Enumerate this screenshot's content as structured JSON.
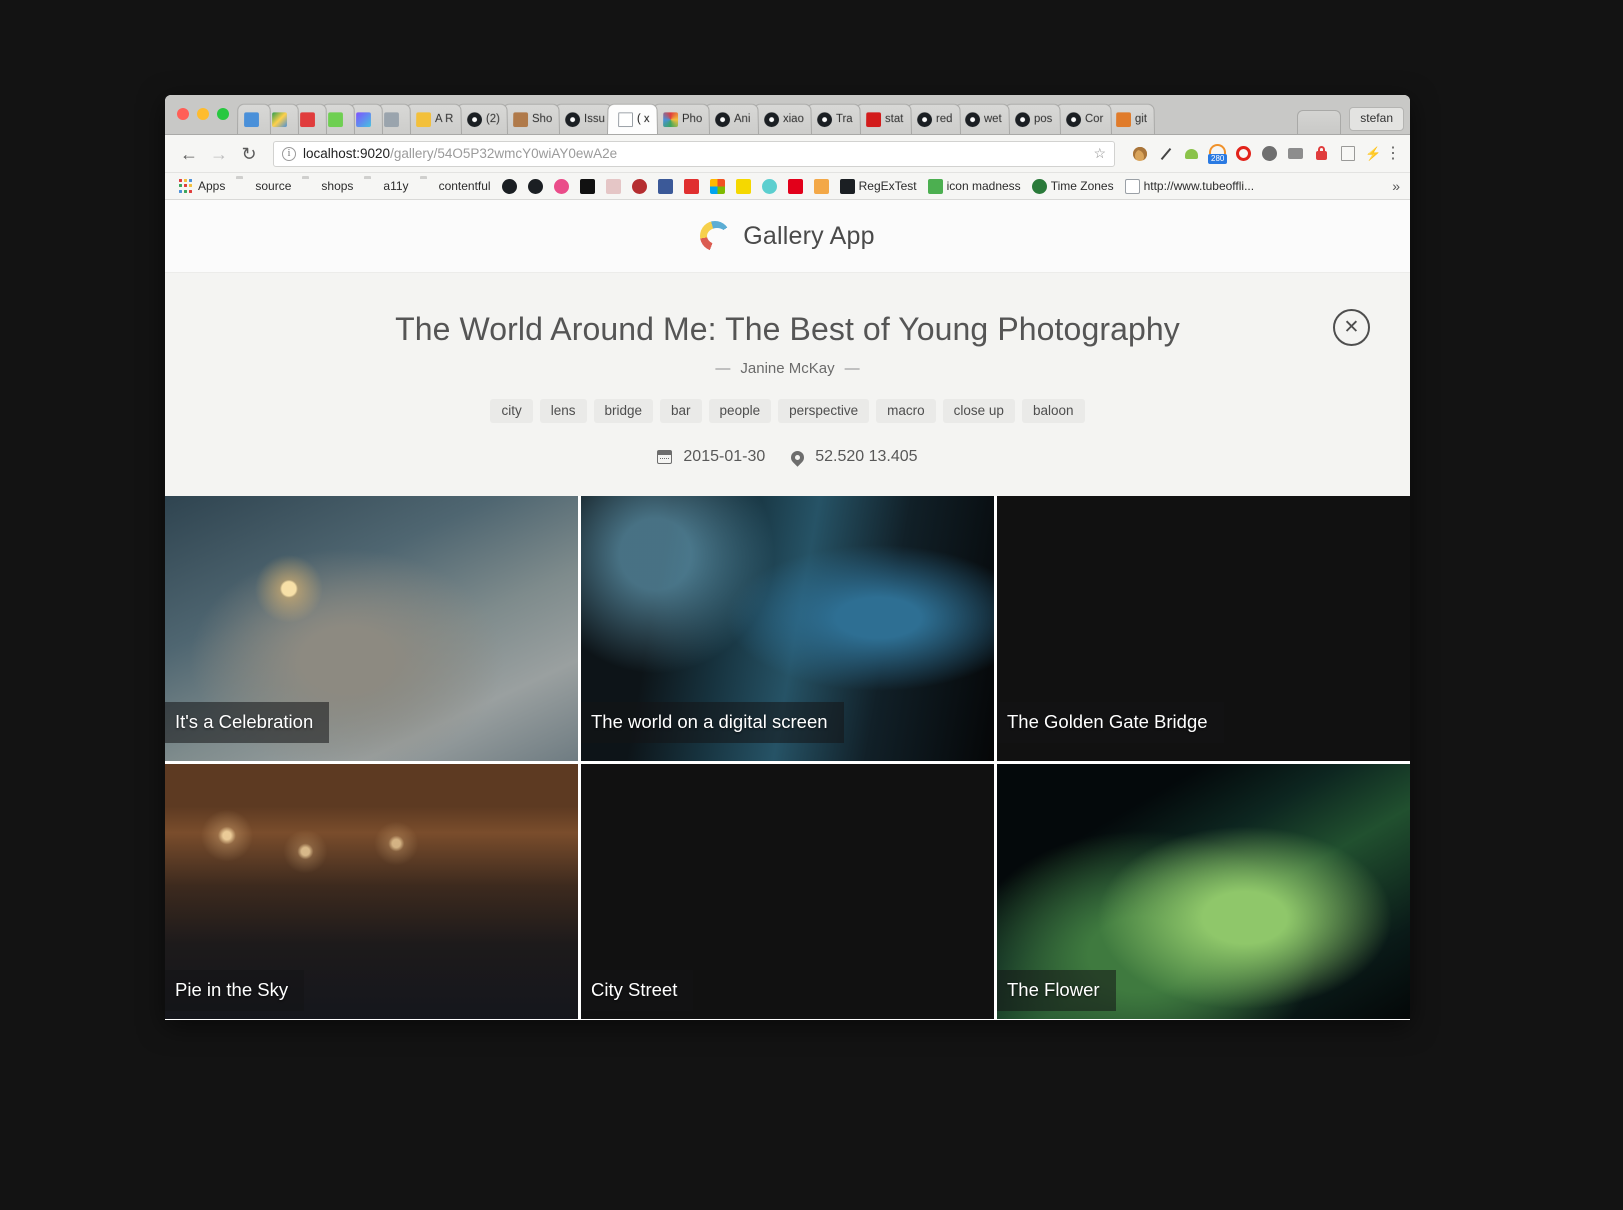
{
  "browser": {
    "tabs": [
      {
        "label": "",
        "favicon_name": "gerrit-icon",
        "color": "#e8e8e6",
        "active": false,
        "narrow": true
      },
      {
        "label": "",
        "favicon_name": "google-drive-icon",
        "color": "#e8e8e6",
        "active": false,
        "narrow": true
      },
      {
        "label": "",
        "favicon_name": "red-app-icon",
        "color": "#e8e8e6",
        "active": false,
        "narrow": true
      },
      {
        "label": "",
        "favicon_name": "green-circle-icon",
        "color": "#e8e8e6",
        "active": false,
        "narrow": true
      },
      {
        "label": "",
        "favicon_name": "kotlin-icon",
        "color": "#e8e8e6",
        "active": false,
        "narrow": true
      },
      {
        "label": "",
        "favicon_name": "refresh-icon",
        "color": "#e8e8e6",
        "active": false,
        "narrow": true
      },
      {
        "label": "A R",
        "favicon_name": "hexagon-icon",
        "color": "#e8e8e6",
        "active": false,
        "narrow": false
      },
      {
        "label": "(2)",
        "favicon_name": "github-icon",
        "color": "#e8e8e6",
        "active": false,
        "narrow": false
      },
      {
        "label": "Sho",
        "favicon_name": "avatar-icon",
        "color": "#e8e8e6",
        "active": false,
        "narrow": false
      },
      {
        "label": "Issu",
        "favicon_name": "github-icon",
        "color": "#e8e8e6",
        "active": false,
        "narrow": false
      },
      {
        "label": "( x",
        "favicon_name": "page-icon",
        "color": "#ffffff",
        "active": true,
        "narrow": false
      },
      {
        "label": "Pho",
        "favicon_name": "photos-icon",
        "color": "#e8e8e6",
        "active": false,
        "narrow": false
      },
      {
        "label": "Ani",
        "favicon_name": "github-icon",
        "color": "#e8e8e6",
        "active": false,
        "narrow": false
      },
      {
        "label": "xiao",
        "favicon_name": "github-icon",
        "color": "#e8e8e6",
        "active": false,
        "narrow": false
      },
      {
        "label": "Tra",
        "favicon_name": "github-icon",
        "color": "#e8e8e6",
        "active": false,
        "narrow": false
      },
      {
        "label": "stat",
        "favicon_name": "red-square-icon",
        "color": "#e8e8e6",
        "active": false,
        "narrow": false
      },
      {
        "label": "red",
        "favicon_name": "github-icon",
        "color": "#e8e8e6",
        "active": false,
        "narrow": false
      },
      {
        "label": "wet",
        "favicon_name": "github-icon",
        "color": "#e8e8e6",
        "active": false,
        "narrow": false
      },
      {
        "label": "pos",
        "favicon_name": "github-icon",
        "color": "#e8e8e6",
        "active": false,
        "narrow": false
      },
      {
        "label": "Cor",
        "favicon_name": "github-icon",
        "color": "#e8e8e6",
        "active": false,
        "narrow": false
      },
      {
        "label": "git",
        "favicon_name": "java-icon",
        "color": "#e8e8e6",
        "active": false,
        "narrow": false
      }
    ],
    "profile_label": "stefan",
    "nav": {
      "back_icon": "back-arrow-icon",
      "forward_icon": "forward-arrow-icon",
      "reload_icon": "reload-icon"
    },
    "url": {
      "host": "localhost:9020",
      "path": "/gallery/54O5P32wmcY0wiAY0ewA2e",
      "full": "localhost:9020/gallery/54O5P32wmcY0wiAY0ewA2e",
      "info_glyph": "i",
      "star_glyph": "☆"
    },
    "extensions": [
      {
        "name": "cookie-icon",
        "glyph": "🍪"
      },
      {
        "name": "eyedropper-icon",
        "glyph": "✐"
      },
      {
        "name": "android-icon",
        "glyph": "●"
      },
      {
        "name": "speedometer-icon",
        "glyph": "",
        "badge": "280"
      },
      {
        "name": "adblock-icon",
        "glyph": "⭕"
      },
      {
        "name": "gray-circle-icon",
        "glyph": "●"
      },
      {
        "name": "camera-icon",
        "glyph": "📷"
      },
      {
        "name": "lock-icon",
        "glyph": "🔒"
      },
      {
        "name": "list-icon",
        "glyph": "☰"
      },
      {
        "name": "lightning-icon",
        "glyph": "⚡"
      }
    ],
    "menu_glyph": "⋮",
    "bookmarks": [
      {
        "label": "Apps",
        "icon": "apps-grid-icon"
      },
      {
        "label": "source",
        "icon": "folder-icon"
      },
      {
        "label": "shops",
        "icon": "folder-icon"
      },
      {
        "label": "a11y",
        "icon": "folder-icon"
      },
      {
        "label": "contentful",
        "icon": "folder-icon"
      },
      {
        "label": "",
        "icon": "codepen-icon"
      },
      {
        "label": "",
        "icon": "github-icon"
      },
      {
        "label": "",
        "icon": "dribbble-icon"
      },
      {
        "label": "",
        "icon": "unsplash-icon"
      },
      {
        "label": "",
        "icon": "faded-icon"
      },
      {
        "label": "",
        "icon": "angular-icon"
      },
      {
        "label": "",
        "icon": "facebook-icon"
      },
      {
        "label": "",
        "icon": "youtube-icon"
      },
      {
        "label": "",
        "icon": "microsoft-icon"
      },
      {
        "label": "",
        "icon": "c-yellow-icon"
      },
      {
        "label": "",
        "icon": "teal-circle-icon"
      },
      {
        "label": "",
        "icon": "sparkasse-icon"
      },
      {
        "label": "",
        "icon": "amazon-icon"
      },
      {
        "label": "RegExTest",
        "icon": "regex-icon"
      },
      {
        "label": "icon madness",
        "icon": "puzzle-icon"
      },
      {
        "label": "Time Zones",
        "icon": "globe-icon"
      },
      {
        "label": "http://www.tubeoffli...",
        "icon": "page-icon"
      }
    ],
    "bookmarks_overflow_glyph": "»"
  },
  "app": {
    "brand": "Gallery App",
    "brand_logo_name": "contentful-c-logo",
    "brand_colors": {
      "blue": "#5badd4",
      "yellow": "#f6d04b",
      "red": "#db5c51"
    }
  },
  "gallery": {
    "title": "The World Around Me: The Best of Young Photography",
    "author": "Janine McKay",
    "author_dash_left": "—",
    "author_dash_right": "—",
    "tags": [
      "city",
      "lens",
      "bridge",
      "bar",
      "people",
      "perspective",
      "macro",
      "close up",
      "baloon"
    ],
    "date": "2015-01-30",
    "location": "52.520 13.405",
    "close_glyph": "✕",
    "photos": [
      {
        "caption": "It's a Celebration",
        "photo_class": "ph-sparkler"
      },
      {
        "caption": "The world on a digital screen",
        "photo_class": "ph-phone"
      },
      {
        "caption": "The Golden Gate Bridge",
        "photo_class": "ph-bridge"
      },
      {
        "caption": "Pie in the Sky",
        "photo_class": "ph-bar"
      },
      {
        "caption": "City Street",
        "photo_class": "ph-street"
      },
      {
        "caption": "The Flower",
        "photo_class": "ph-flower"
      }
    ]
  }
}
